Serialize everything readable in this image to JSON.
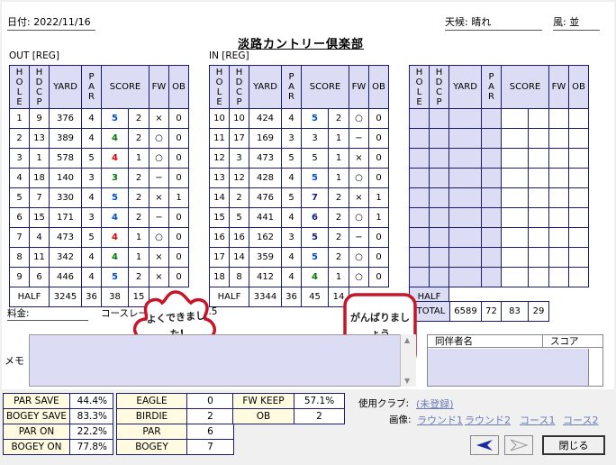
{
  "header": {
    "date": "日付: 2022/11/16",
    "weather": "天候: 晴れ",
    "wind": "風: 並",
    "club": "淡路カントリー倶楽部"
  },
  "out_label": "OUT [REG]",
  "in_label": "IN [REG]",
  "columns": {
    "hole": "HOLE",
    "hdcp": "HDCP",
    "yard": "YARD",
    "par": "PAR",
    "score": "SCORE",
    "fw": "FW",
    "ob": "OB"
  },
  "colors": {
    "navy": "#1a1a6e",
    "lavender": "#dcdcf5",
    "blue": "#0050c8",
    "red": "#e00000",
    "green": "#007a00",
    "cream": "#fffbe0"
  },
  "out": [
    {
      "hole": "1",
      "hdcp": "9",
      "yard": "376",
      "par": "4",
      "score": "5",
      "color": "blue",
      "putt": "2",
      "fw": "×",
      "ob": "0"
    },
    {
      "hole": "2",
      "hdcp": "13",
      "yard": "389",
      "par": "4",
      "score": "4",
      "color": "green",
      "putt": "2",
      "fw": "○",
      "ob": "0"
    },
    {
      "hole": "3",
      "hdcp": "1",
      "yard": "578",
      "par": "5",
      "score": "4",
      "color": "red",
      "putt": "1",
      "fw": "○",
      "ob": "0"
    },
    {
      "hole": "4",
      "hdcp": "18",
      "yard": "140",
      "par": "3",
      "score": "3",
      "color": "green",
      "putt": "2",
      "fw": "−",
      "ob": "0"
    },
    {
      "hole": "5",
      "hdcp": "7",
      "yard": "330",
      "par": "4",
      "score": "5",
      "color": "blue",
      "putt": "2",
      "fw": "×",
      "ob": "1"
    },
    {
      "hole": "6",
      "hdcp": "15",
      "yard": "171",
      "par": "3",
      "score": "4",
      "color": "blue",
      "putt": "2",
      "fw": "−",
      "ob": "0"
    },
    {
      "hole": "7",
      "hdcp": "4",
      "yard": "473",
      "par": "5",
      "score": "4",
      "color": "red",
      "putt": "1",
      "fw": "○",
      "ob": "0"
    },
    {
      "hole": "8",
      "hdcp": "11",
      "yard": "342",
      "par": "4",
      "score": "4",
      "color": "green",
      "putt": "1",
      "fw": "×",
      "ob": "0"
    },
    {
      "hole": "9",
      "hdcp": "6",
      "yard": "446",
      "par": "4",
      "score": "5",
      "color": "blue",
      "putt": "2",
      "fw": "×",
      "ob": "0"
    }
  ],
  "out_half": {
    "label": "HALF",
    "yard": "3245",
    "par": "36",
    "score": "38",
    "putt": "15"
  },
  "in": [
    {
      "hole": "10",
      "hdcp": "10",
      "yard": "424",
      "par": "4",
      "score": "5",
      "color": "blue",
      "putt": "2",
      "fw": "○",
      "ob": "0"
    },
    {
      "hole": "11",
      "hdcp": "17",
      "yard": "169",
      "par": "3",
      "score": "3",
      "color": "black",
      "putt": "1",
      "fw": "−",
      "ob": "0"
    },
    {
      "hole": "12",
      "hdcp": "3",
      "yard": "473",
      "par": "5",
      "score": "5",
      "color": "black",
      "putt": "1",
      "fw": "×",
      "ob": "0"
    },
    {
      "hole": "13",
      "hdcp": "12",
      "yard": "428",
      "par": "4",
      "score": "5",
      "color": "blue",
      "putt": "1",
      "fw": "○",
      "ob": "0"
    },
    {
      "hole": "14",
      "hdcp": "2",
      "yard": "476",
      "par": "5",
      "score": "7",
      "color": "navy",
      "putt": "2",
      "fw": "×",
      "ob": "1"
    },
    {
      "hole": "15",
      "hdcp": "5",
      "yard": "441",
      "par": "4",
      "score": "6",
      "color": "navy",
      "putt": "2",
      "fw": "○",
      "ob": "1"
    },
    {
      "hole": "16",
      "hdcp": "16",
      "yard": "162",
      "par": "3",
      "score": "5",
      "color": "navy",
      "putt": "2",
      "fw": "−",
      "ob": "0"
    },
    {
      "hole": "17",
      "hdcp": "14",
      "yard": "359",
      "par": "4",
      "score": "5",
      "color": "blue",
      "putt": "2",
      "fw": "○",
      "ob": "0"
    },
    {
      "hole": "18",
      "hdcp": "8",
      "yard": "412",
      "par": "4",
      "score": "4",
      "color": "green",
      "putt": "1",
      "fw": "○",
      "ob": "0"
    }
  ],
  "in_half": {
    "label": "HALF",
    "yard": "3344",
    "par": "36",
    "score": "45",
    "putt": "14"
  },
  "third_half_label": "HALF",
  "total": {
    "label": "TOTAL",
    "yard": "6589",
    "par": "72",
    "score": "83",
    "putt": "29"
  },
  "fee_label": "料金:",
  "course_rate_label": "コースレート:",
  "course_rate": "71.5",
  "stickers": {
    "left": "よくできました!",
    "right": "がんばりましょう"
  },
  "memo_label": "メモ",
  "companions": {
    "name_header": "同伴者名",
    "score_header": "スコア"
  },
  "stats_left": [
    {
      "k": "PAR SAVE",
      "v": "44.4%"
    },
    {
      "k": "BOGEY SAVE",
      "v": "83.3%"
    },
    {
      "k": "PAR ON",
      "v": "22.2%"
    },
    {
      "k": "BOGEY ON",
      "v": "77.8%"
    }
  ],
  "stats_mid": [
    {
      "k": "EAGLE",
      "v": "0"
    },
    {
      "k": "BIRDIE",
      "v": "2"
    },
    {
      "k": "PAR",
      "v": "6"
    },
    {
      "k": "BOGEY",
      "v": "7"
    }
  ],
  "stats_right": [
    {
      "k": "FW KEEP",
      "v": "57.1%"
    },
    {
      "k": "OB",
      "v": "2"
    }
  ],
  "clubs_label": "使用クラブ:",
  "clubs_value": "(未登録)",
  "image_label": "画像:",
  "image_links": [
    "ラウンド1",
    "ラウンド2",
    "コース1",
    "コース2"
  ],
  "buttons": {
    "close": "閉じる"
  }
}
